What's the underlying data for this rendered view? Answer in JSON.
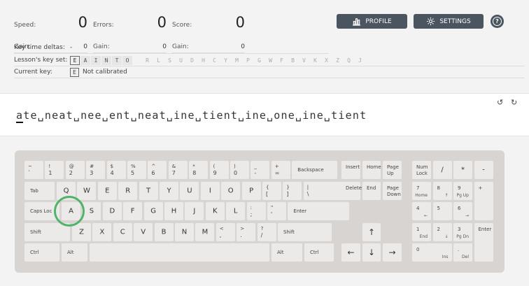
{
  "stats": {
    "speed": {
      "label": "Speed:",
      "value": "0",
      "gain_label": "Gain:",
      "gain": "0"
    },
    "errors": {
      "label": "Errors:",
      "value": "0",
      "gain_label": "Gain:",
      "gain": "0"
    },
    "score": {
      "label": "Score:",
      "value": "0",
      "gain_label": "Gain:",
      "gain": "0"
    }
  },
  "info": {
    "key_time_label": "Key time deltas:",
    "key_time_value": "-",
    "lesson_keyset_label": "Lesson's key set:",
    "active_keys": [
      "E",
      "A",
      "I",
      "N",
      "T",
      "O"
    ],
    "inactive_keys": [
      "R",
      "L",
      "S",
      "U",
      "D",
      "H",
      "C",
      "Y",
      "M",
      "P",
      "G",
      "W",
      "F",
      "B",
      "V",
      "K",
      "X",
      "Z",
      "Q",
      "J"
    ],
    "current_key_label": "Current key:",
    "current_key": "E",
    "current_key_status": "Not calibrated"
  },
  "header": {
    "profile_label": "PROFILE",
    "settings_label": "SETTINGS",
    "help_label": "?"
  },
  "lesson": {
    "current": "a",
    "rest": "te␣neat␣nee␣ent␣neat␣ine␣tient␣ine␣one␣ine␣tient",
    "icons": [
      "reset-icon",
      "refresh-icon"
    ]
  },
  "keyboard": {
    "row1": [
      [
        "~",
        "`"
      ],
      [
        "!",
        "1"
      ],
      [
        "@",
        "2"
      ],
      [
        "#",
        "3"
      ],
      [
        "$",
        "4"
      ],
      [
        "%",
        "5"
      ],
      [
        "^",
        "6"
      ],
      [
        "&",
        "7"
      ],
      [
        "*",
        "8"
      ],
      [
        "(",
        "9"
      ],
      [
        ")",
        "0"
      ],
      [
        "_",
        "-"
      ],
      [
        "+",
        "="
      ]
    ],
    "backspace": "Backspace",
    "tab": "Tab",
    "row2": [
      "Q",
      "W",
      "E",
      "R",
      "T",
      "Y",
      "U",
      "I",
      "O",
      "P"
    ],
    "row2_sym": [
      [
        "{",
        "["
      ],
      [
        "}",
        "]"
      ],
      [
        "|",
        "\\"
      ]
    ],
    "caps": "Caps Loc",
    "row3": [
      "A",
      "S",
      "D",
      "F",
      "G",
      "H",
      "J",
      "K",
      "L"
    ],
    "row3_sym": [
      [
        ":",
        ";"
      ],
      [
        "\"",
        "'"
      ]
    ],
    "enter": "Enter",
    "shift": "Shift",
    "row4": [
      "Z",
      "X",
      "C",
      "V",
      "B",
      "N",
      "M"
    ],
    "row4_sym": [
      [
        "<",
        ","
      ],
      [
        ">",
        "."
      ],
      [
        "?",
        "/"
      ]
    ],
    "ctrl": "Ctrl",
    "alt": "Alt",
    "nav": {
      "insert": "Insert",
      "home": "Home",
      "page_up": "Page Up",
      "delete": "Delete",
      "end": "End",
      "page_down": "Page Down"
    },
    "arrows": {
      "up": "↑",
      "left": "←",
      "down": "↓",
      "right": "→"
    },
    "numpad": {
      "num_lock": "Num Lock",
      "div": "/",
      "mul": "*",
      "minus": "-",
      "plus": "+",
      "enter": "Enter",
      "n7": [
        "7",
        "Home"
      ],
      "n8": [
        "8",
        "↑"
      ],
      "n9": [
        "9",
        "Pg Up"
      ],
      "n4": [
        "4",
        "←"
      ],
      "n5": [
        "5",
        ""
      ],
      "n6": [
        "6",
        "→"
      ],
      "n1": [
        "1",
        "End"
      ],
      "n2": [
        "2",
        "↓"
      ],
      "n3": [
        "3",
        "Pg Dn"
      ],
      "n0": [
        "0",
        "Ins"
      ],
      "dot": [
        ".",
        "Del"
      ]
    },
    "highlight_key": "A",
    "accent_color": "#4fb36a"
  }
}
